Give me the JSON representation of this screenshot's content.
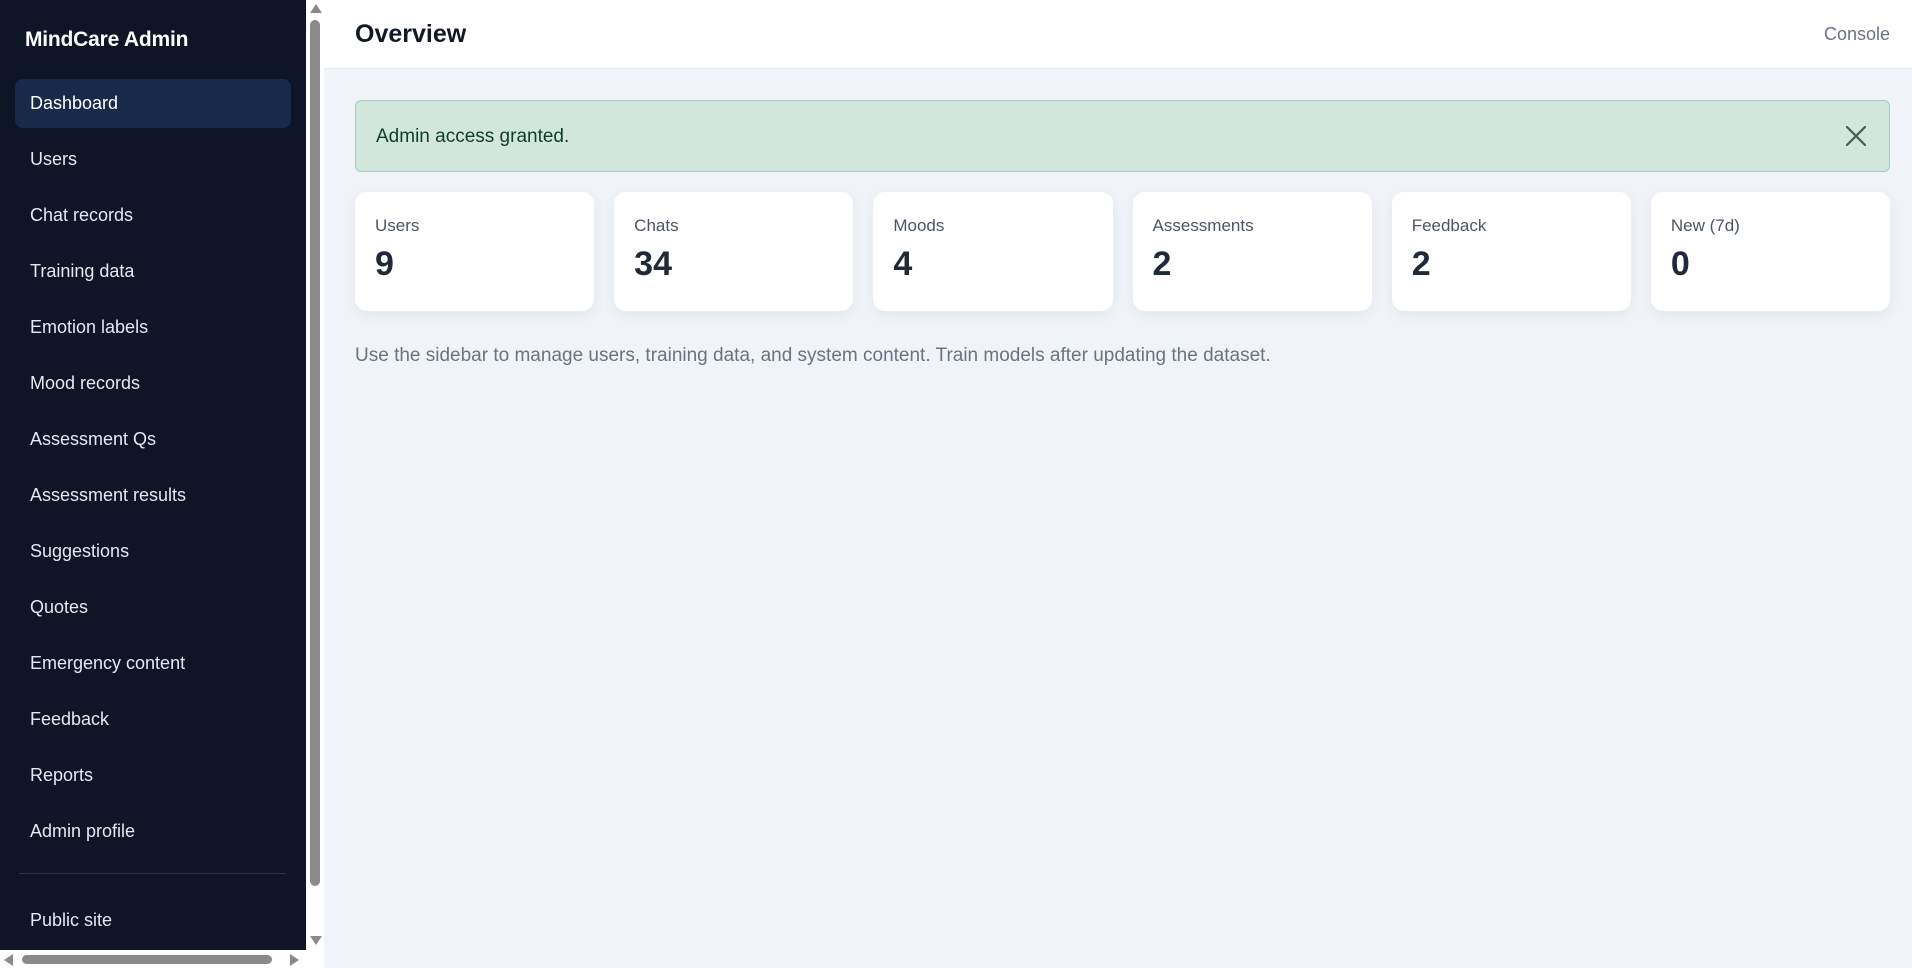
{
  "sidebar": {
    "brand": "MindCare Admin",
    "items": [
      {
        "label": "Dashboard",
        "active": true
      },
      {
        "label": "Users"
      },
      {
        "label": "Chat records"
      },
      {
        "label": "Training data"
      },
      {
        "label": "Emotion labels"
      },
      {
        "label": "Mood records"
      },
      {
        "label": "Assessment Qs"
      },
      {
        "label": "Assessment results"
      },
      {
        "label": "Suggestions"
      },
      {
        "label": "Quotes"
      },
      {
        "label": "Emergency content"
      },
      {
        "label": "Feedback"
      },
      {
        "label": "Reports"
      },
      {
        "label": "Admin profile"
      }
    ],
    "public_site": "Public site"
  },
  "header": {
    "title": "Overview",
    "console": "Console"
  },
  "alert": {
    "message": "Admin access granted.",
    "close_icon": "close-icon"
  },
  "stats": [
    {
      "label": "Users",
      "value": "9"
    },
    {
      "label": "Chats",
      "value": "34"
    },
    {
      "label": "Moods",
      "value": "4"
    },
    {
      "label": "Assessments",
      "value": "2"
    },
    {
      "label": "Feedback",
      "value": "2"
    },
    {
      "label": "New (7d)",
      "value": "0"
    }
  ],
  "hint": "Use the sidebar to manage users, training data, and system content. Train models after updating the dataset.",
  "colors": {
    "sidebar_bg": "#0d1526",
    "sidebar_active": "#182a4a",
    "alert_bg": "#d1e7dd",
    "content_bg": "#f0f4f8"
  }
}
